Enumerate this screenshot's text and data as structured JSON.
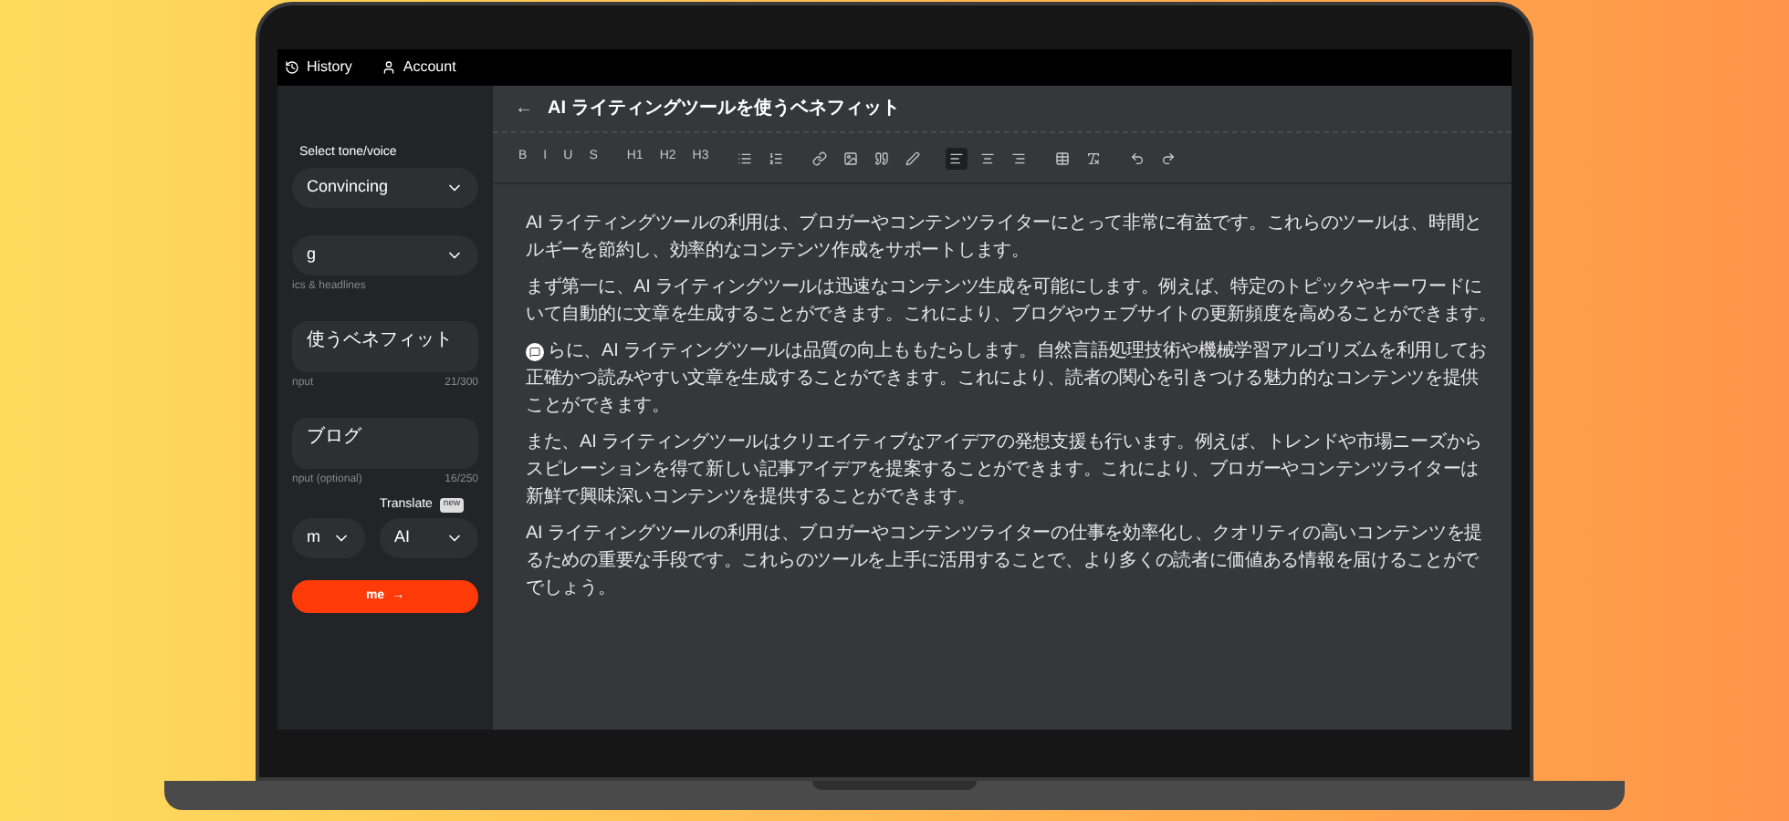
{
  "topbar": {
    "links": [
      {
        "label": "History"
      },
      {
        "label": "Account"
      }
    ]
  },
  "sidebar": {
    "tone": {
      "label": "Select tone/voice",
      "value": "Convincing"
    },
    "topic_select": {
      "value": "g",
      "hint": "ics & headlines"
    },
    "title_input": {
      "value": "使うベネフィット",
      "hint": "nput",
      "count": "21/300"
    },
    "keywords_input": {
      "value": "ブログ",
      "hint": "nput (optional)",
      "count": "16/250"
    },
    "translate": {
      "label": "Translate",
      "badge": "new",
      "left_value": "m",
      "right_value": "AI"
    },
    "button": {
      "label": "me",
      "arrow": "→"
    }
  },
  "editor": {
    "back": "←",
    "title": "AI ライティングツールを使うベネフィット",
    "toolbar": [
      [
        {
          "kind": "text",
          "label": "B",
          "selected": false
        },
        {
          "kind": "text",
          "label": "I",
          "selected": false
        },
        {
          "kind": "text",
          "label": "U",
          "selected": false
        },
        {
          "kind": "text",
          "label": "S",
          "selected": false
        }
      ],
      [
        {
          "kind": "text",
          "label": "H1",
          "selected": false
        },
        {
          "kind": "text",
          "label": "H2",
          "selected": false
        },
        {
          "kind": "text",
          "label": "H3",
          "selected": false
        }
      ],
      [
        {
          "kind": "icon",
          "selected": false
        },
        {
          "kind": "icon",
          "selected": false
        }
      ],
      [
        {
          "kind": "icon",
          "selected": false
        },
        {
          "kind": "icon",
          "selected": false
        },
        {
          "kind": "icon",
          "selected": false
        },
        {
          "kind": "icon",
          "selected": false
        }
      ],
      [
        {
          "kind": "icon",
          "selected": true
        },
        {
          "kind": "icon",
          "selected": false
        },
        {
          "kind": "icon",
          "selected": false
        }
      ],
      [
        {
          "kind": "icon",
          "selected": false
        },
        {
          "kind": "icon",
          "selected": false
        }
      ],
      [
        {
          "kind": "icon",
          "selected": false
        },
        {
          "kind": "icon",
          "selected": false
        }
      ]
    ],
    "paragraphs": [
      {
        "lines": [
          "AI ライティングツールの利用は、ブロガーやコンテンツライターにとって非常に有益です。これらのツールは、時間と",
          "ルギーを節約し、効率的なコンテンツ作成をサポートします。"
        ]
      },
      {
        "lines": [
          "まず第一に、AI ライティングツールは迅速なコンテンツ生成を可能にします。例えば、特定のトピックやキーワードに",
          "いて自動的に文章を生成することができます。これにより、ブログやウェブサイトの更新頻度を高めることができます。"
        ]
      },
      {
        "lines": [
          "らに、AI ライティングツールは品質の向上ももたらします。自然言語処理技術や機械学習アルゴリズムを利用してお",
          "正確かつ読みやすい文章を生成することができます。これにより、読者の関心を引きつける魅力的なコンテンツを提供",
          "ことができます。"
        ],
        "cursor": true
      },
      {
        "lines": [
          "また、AI ライティングツールはクリエイティブなアイデアの発想支援も行います。例えば、トレンドや市場ニーズから",
          "スピレーションを得て新しい記事アイデアを提案することができます。これにより、ブロガーやコンテンツライターは",
          "新鮮で興味深いコンテンツを提供することができます。"
        ]
      },
      {
        "lines": [
          "AI ライティングツールの利用は、ブロガーやコンテンツライターの仕事を効率化し、クオリティの高いコンテンツを提",
          "るための重要な手段です。これらのツールを上手に活用することで、より多くの読者に価値ある情報を届けることがで",
          "でしょう。"
        ]
      }
    ]
  }
}
